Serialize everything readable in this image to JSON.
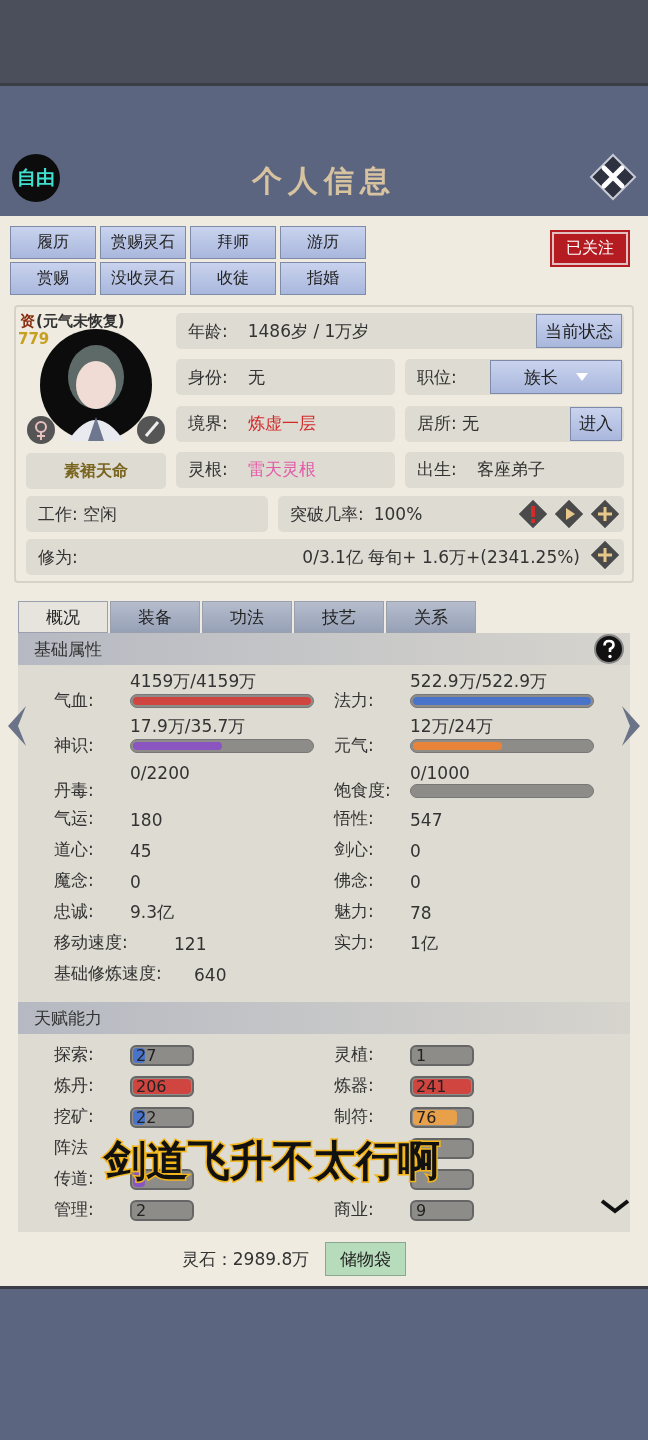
{
  "header": {
    "status_badge": "自由",
    "title": "个人信息"
  },
  "action_buttons": [
    {
      "label": "履历"
    },
    {
      "label": "赏赐灵石"
    },
    {
      "label": "拜师"
    },
    {
      "label": "游历"
    },
    {
      "label": "赏赐"
    },
    {
      "label": "没收灵石"
    },
    {
      "label": "收徒"
    },
    {
      "label": "指婚"
    }
  ],
  "follow_stamp": "已关注",
  "profile": {
    "aptitude_label": "资",
    "aptitude_value": "779",
    "condition": "(元气未恢复)",
    "title_plate": "素裙天命",
    "age_label": "年龄:",
    "age_value": "1486岁 / 1万岁",
    "status_button": "当前状态",
    "identity_label": "身份:",
    "identity_value": "无",
    "position_label": "职位:",
    "position_value": "族长",
    "realm_label": "境界:",
    "realm_value": "炼虚一层",
    "residence": "居所: 无",
    "enter_button": "进入",
    "root_label": "灵根:",
    "root_value": "雷天灵根",
    "birth_label": "出生:",
    "birth_value": "客座弟子",
    "work": "工作: 空闲",
    "breakthrough_label": "突破几率:",
    "breakthrough_value": "100%",
    "cultivation_label": "修为:",
    "cultivation_value": "0/3.1亿  每旬+  1.6万+(2341.25%)"
  },
  "tabs": [
    {
      "label": "概况",
      "selected": true
    },
    {
      "label": "装备",
      "selected": false
    },
    {
      "label": "功法",
      "selected": false
    },
    {
      "label": "技艺",
      "selected": false
    },
    {
      "label": "关系",
      "selected": false
    }
  ],
  "basic_section": {
    "title": "基础属性",
    "bars": [
      {
        "kind": "bar",
        "label": "气血:",
        "value": "4159万/4159万",
        "level": 1,
        "color": "#d0453f"
      },
      {
        "kind": "bar",
        "label": "法力:",
        "value": "522.9万/522.9万",
        "level": 1,
        "color": "#4a74c9"
      },
      {
        "kind": "bar",
        "label": "神识:",
        "value": "17.9万/35.7万",
        "level": 0.5,
        "color": "#8a55c0"
      },
      {
        "kind": "bar",
        "label": "元气:",
        "value": "12万/24万",
        "level": 0.5,
        "color": "#e8843a"
      },
      {
        "kind": "text",
        "label": "丹毒:",
        "value": "0/2200"
      },
      {
        "kind": "bar",
        "label": "饱食度:",
        "value": "0/1000"
      }
    ],
    "stats": [
      {
        "label": "气运:",
        "value": "180"
      },
      {
        "label": "悟性:",
        "value": "547"
      },
      {
        "label": "道心:",
        "value": "45"
      },
      {
        "label": "剑心:",
        "value": "0"
      },
      {
        "label": "魔念:",
        "value": "0"
      },
      {
        "label": "佛念:",
        "value": "0"
      },
      {
        "label": "忠诚:",
        "value": "9.3亿"
      },
      {
        "label": "魅力:",
        "value": "78"
      },
      {
        "label": "移动速度:",
        "value": "121"
      },
      {
        "label": "实力:",
        "value": "1亿"
      },
      {
        "label": "基础修炼速度:",
        "value": "640"
      }
    ]
  },
  "talent_section": {
    "title": "天赋能力",
    "talents": [
      {
        "kind": "bar",
        "label": "探索:",
        "value": "27",
        "level": 0.2,
        "color": "#4a74c9"
      },
      {
        "kind": "bar",
        "label": "灵植:",
        "value": "1"
      },
      {
        "kind": "bar",
        "label": "炼丹:",
        "value": "206",
        "level": 1,
        "color": "#d0453f"
      },
      {
        "kind": "bar",
        "label": "炼器:",
        "value": "241",
        "level": 1,
        "color": "#d0453f"
      },
      {
        "kind": "bar",
        "label": "挖矿:",
        "value": "22",
        "level": 0.2,
        "color": "#4a74c9"
      },
      {
        "kind": "bar",
        "label": "制符:",
        "value": "76",
        "level": 0.75,
        "color": "#e8a04a"
      },
      {
        "kind": "text",
        "label": "阵法"
      },
      {
        "kind": "bar"
      },
      {
        "kind": "bar",
        "label": "传道:",
        "level": 0.2,
        "color": "#8a55c0"
      },
      {
        "kind": "bar"
      },
      {
        "kind": "bar",
        "label": "管理:",
        "value": "2"
      },
      {
        "kind": "bar",
        "label": "商业:",
        "value": "9"
      }
    ]
  },
  "footer": {
    "spirit_stones": "灵石：2989.8万",
    "bag_button": "储物袋"
  },
  "caption": "剑道飞升不太行啊"
}
